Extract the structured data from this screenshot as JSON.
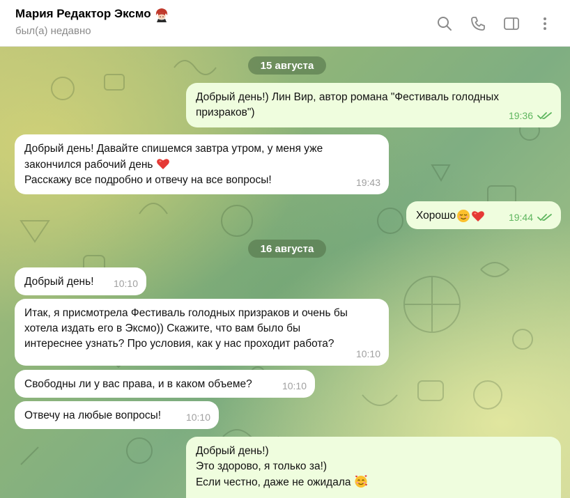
{
  "header": {
    "contact_name": "Мария Редактор Эксмо",
    "status": "был(а) недавно",
    "icons": [
      "search-icon",
      "phone-icon",
      "sidebar-icon",
      "more-icon"
    ]
  },
  "colors": {
    "incoming_bubble": "#ffffff",
    "outgoing_bubble": "#effdde",
    "outgoing_time": "#5fb65f",
    "incoming_time": "#a0a0a0",
    "date_pill": "#54744a"
  },
  "messages": {
    "date1": "15 августа",
    "m1": {
      "text": "Добрый день!) Лин Вир, автор романа \"Фестиваль голодных\nпризраков\")",
      "time": "19:36",
      "read": true
    },
    "m2": {
      "text_line1": "Добрый день! Давайте спишемся завтра утром, у меня уже",
      "text_line2": "закончился рабочий день",
      "text_line3": "Расскажу все подробно и отвечу на все вопросы!",
      "emoji": "heart",
      "time": "19:43"
    },
    "m3": {
      "text": "Хорошо",
      "emojis": [
        "relieved-face",
        "heart"
      ],
      "time": "19:44",
      "read": true
    },
    "date2": "16 августа",
    "m4": {
      "text": "Добрый день!",
      "time": "10:10"
    },
    "m5": {
      "text": "Итак, я присмотрела Фестиваль голодных призраков и очень бы\nхотела издать его в Эксмо)) Скажите, что вам было бы\nинтереснее узнать? Про условия, как у нас проходит работа?",
      "time": "10:10"
    },
    "m6": {
      "text": "Свободны ли у вас права, и в каком объеме?",
      "time": "10:10"
    },
    "m7": {
      "text": "Отвечу на любые вопросы!",
      "time": "10:10"
    },
    "m8": {
      "text_line1": "Добрый день!)",
      "text_line2": "Это здорово, я только за!)",
      "text_line3": "Если честно, даже не ожидала",
      "emoji": "smiling-face-with-hearts"
    }
  }
}
